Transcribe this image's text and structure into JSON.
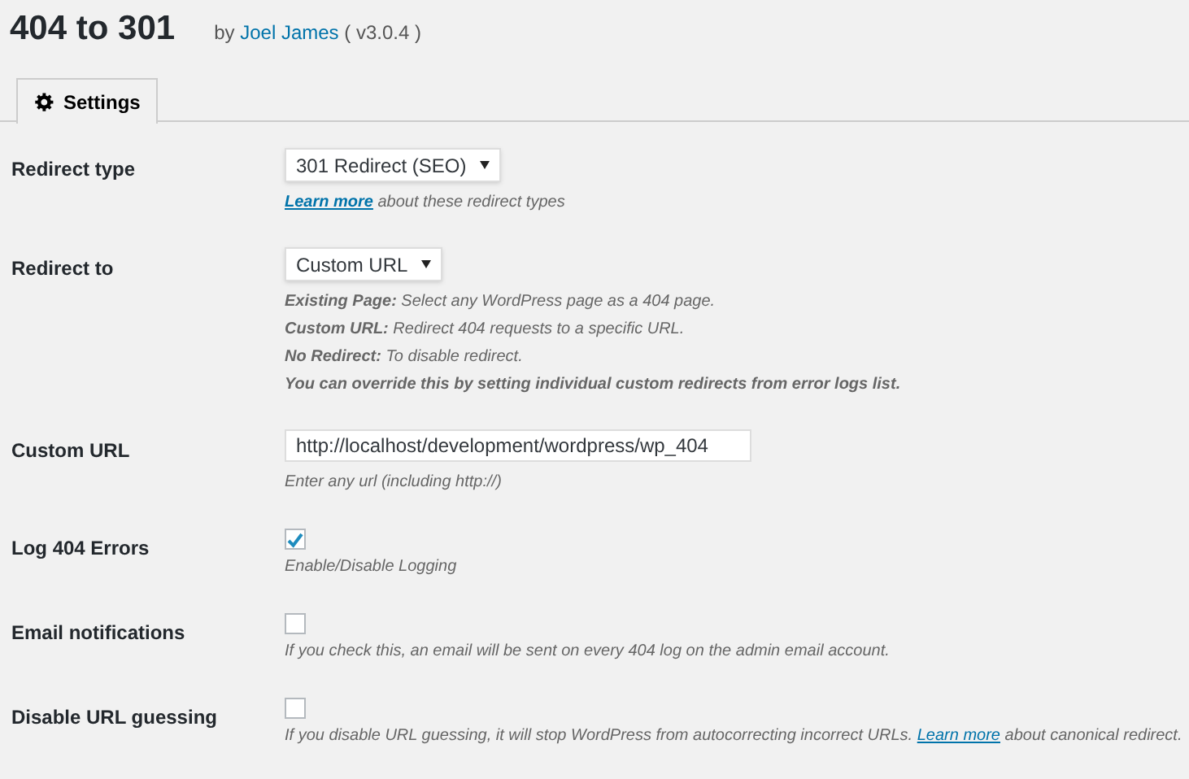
{
  "header": {
    "title": "404 to 301",
    "byline_prefix": "by",
    "author": "Joel James",
    "version": "( v3.0.4 )"
  },
  "tabs": [
    {
      "label": "Settings",
      "selected": true
    }
  ],
  "rows": [
    {
      "kind": "select",
      "label": "Redirect type",
      "value": "301 Redirect (SEO)",
      "help": [
        {
          "link": "Learn more",
          "after": " about these redirect types"
        }
      ]
    },
    {
      "kind": "select",
      "label": "Redirect to",
      "value": "Custom URL",
      "help": [
        {
          "text": "**Existing Page:** Select any WordPress page as a 404 page."
        },
        {
          "text": "**Custom URL:** Redirect 404 requests to a specific URL."
        },
        {
          "text": "**No Redirect:** To disable redirect."
        },
        {
          "text": "**You can override this by setting individual custom redirects from error logs list.**"
        }
      ]
    },
    {
      "kind": "input",
      "label": "Custom URL",
      "value": "http://localhost/development/wordpress/wp_404",
      "help": [
        {
          "text": "Enter any url (including http://)"
        }
      ]
    },
    {
      "kind": "checkbox",
      "label": "Log 404 Errors",
      "checked": true,
      "help": [
        {
          "text": "Enable/Disable Logging"
        }
      ]
    },
    {
      "kind": "checkbox",
      "label": "Email notifications",
      "checked": false,
      "help": [
        {
          "text": "If you check this, an email will be sent on every 404 log on the admin email account."
        }
      ]
    },
    {
      "kind": "checkbox",
      "label": "Disable URL guessing",
      "checked": false,
      "help": [
        {
          "before": "If you disable URL guessing, it will stop WordPress from autocorrecting incorrect URLs. ",
          "link": "Learn more",
          "after": " about canonical redirect."
        }
      ]
    }
  ]
}
